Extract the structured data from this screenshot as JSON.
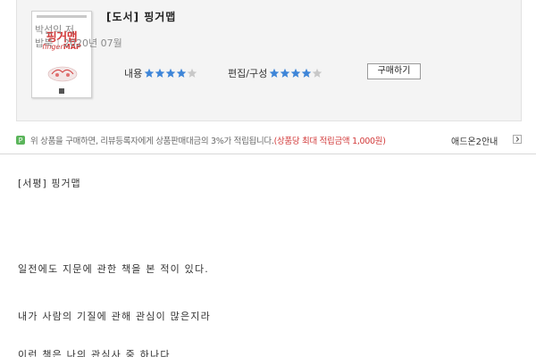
{
  "product": {
    "title": "[도서] 핑거맵",
    "author": "박선익 저",
    "publisher": "밥북",
    "date": "2020년 07월",
    "cover": {
      "title": "핑거맵",
      "subtitle_a": "finger",
      "subtitle_b": "MAP"
    },
    "ratings": [
      {
        "label": "내용",
        "stars": 4,
        "max": 5
      },
      {
        "label": "편집/구성",
        "stars": 4,
        "max": 5
      }
    ],
    "buy_label": "구매하기"
  },
  "notice": {
    "text": "위 상품을 구매하면, 리뷰등록자에게 상품판매대금의 3%가 적립됩니다.",
    "highlight": "(상품당 최대 적립금액 1,000원)",
    "addon_label": "애드온2안내"
  },
  "review": {
    "heading": "[서평] 핑거맵",
    "lines": [
      "일전에도 지문에 관한 책을 본 적이 있다.",
      "내가 사람의 기질에 관해 관심이 많은지라",
      "이런 책은 나의 관심사 중 하나다"
    ]
  },
  "colors": {
    "star_filled": "#3f86d8",
    "star_empty": "#c8c8c8",
    "accent_red": "#d23a3a",
    "notice_icon": "#5bb55b"
  }
}
